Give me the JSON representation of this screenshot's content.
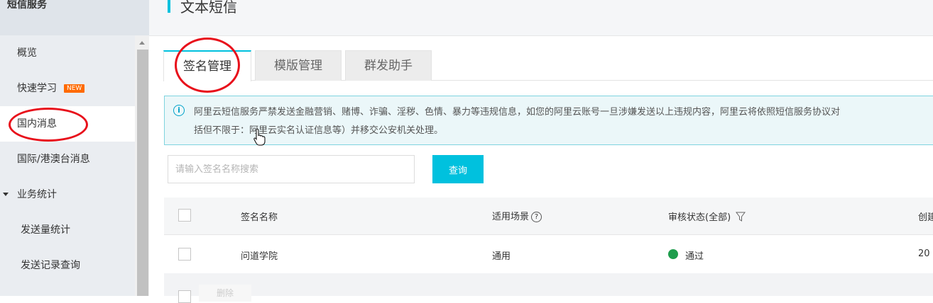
{
  "sidebar": {
    "title": "短信服务",
    "items": [
      {
        "label": "概览"
      },
      {
        "label": "快速学习",
        "badge": "NEW"
      },
      {
        "label": "国内消息"
      },
      {
        "label": "国际/港澳台消息"
      },
      {
        "label": "业务统计"
      },
      {
        "label": "发送量统计"
      },
      {
        "label": "发送记录查询"
      }
    ]
  },
  "page": {
    "title": "文本短信"
  },
  "tabs": [
    {
      "label": "签名管理"
    },
    {
      "label": "模版管理"
    },
    {
      "label": "群发助手"
    }
  ],
  "notice": {
    "text": "阿里云短信服务严禁发送金融营销、赌博、诈骗、淫秽、色情、暴力等违规信息，如您的阿里云账号一旦涉嫌发送以上违规内容，阿里云将依照短信服务协议对\n括但不限于：阿里云实名认证信息等）并移交公安机关处理。"
  },
  "search": {
    "placeholder": "请输入签名名称搜索",
    "button": "查询"
  },
  "table": {
    "columns": [
      "签名名称",
      "适用场景",
      "审核状态(全部)",
      "创建"
    ],
    "rows": [
      {
        "name": "问道学院",
        "scene": "通用",
        "status": "通过",
        "created": "20"
      }
    ],
    "footer_button": "删除"
  },
  "colors": {
    "accent": "#00c1de",
    "annotation": "#e8101b",
    "status_ok": "#1e9d4c"
  }
}
